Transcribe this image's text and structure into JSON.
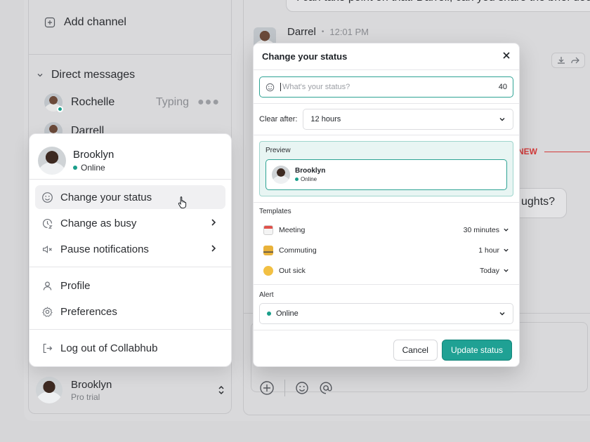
{
  "sidebar": {
    "add_channel": "Add channel",
    "direct_messages": "Direct messages",
    "dm_items": [
      {
        "name": "Rochelle",
        "typing": "Typing"
      },
      {
        "name": "Darrell"
      }
    ],
    "footer_user": {
      "name": "Brooklyn",
      "plan": "Pro trial"
    }
  },
  "chat": {
    "prev_message": "I can take point on that. Darrell, can you share the brief doc",
    "author": "Darrel",
    "time": "12:01 PM",
    "new_label": "NEW",
    "question_tail": "ughts?"
  },
  "menu": {
    "user_name": "Brooklyn",
    "user_status": "Online",
    "items": {
      "change_status": "Change your status",
      "change_busy": "Change as busy",
      "pause_notifications": "Pause notifications",
      "profile": "Profile",
      "preferences": "Preferences",
      "logout": "Log out of Collabhub"
    }
  },
  "dialog": {
    "title": "Change your status",
    "status_placeholder": "What's your status?",
    "char_count": "40",
    "clear_after_label": "Clear after:",
    "clear_after_value": "12 hours",
    "preview_label": "Preview",
    "preview_name": "Brooklyn",
    "preview_status": "Online",
    "templates_label": "Templates",
    "templates": [
      {
        "label": "Meeting",
        "duration": "30 minutes",
        "icon": "calendar-emoji-icon"
      },
      {
        "label": "Commuting",
        "duration": "1 hour",
        "icon": "bus-emoji-icon"
      },
      {
        "label": "Out sick",
        "duration": "Today",
        "icon": "sick-face-emoji-icon"
      }
    ],
    "alert_label": "Alert",
    "alert_value": "Online",
    "cancel": "Cancel",
    "update": "Update status"
  },
  "colors": {
    "accent": "#1fa194",
    "presence": "#1a9e8a",
    "new_marker": "#d33a3a"
  }
}
